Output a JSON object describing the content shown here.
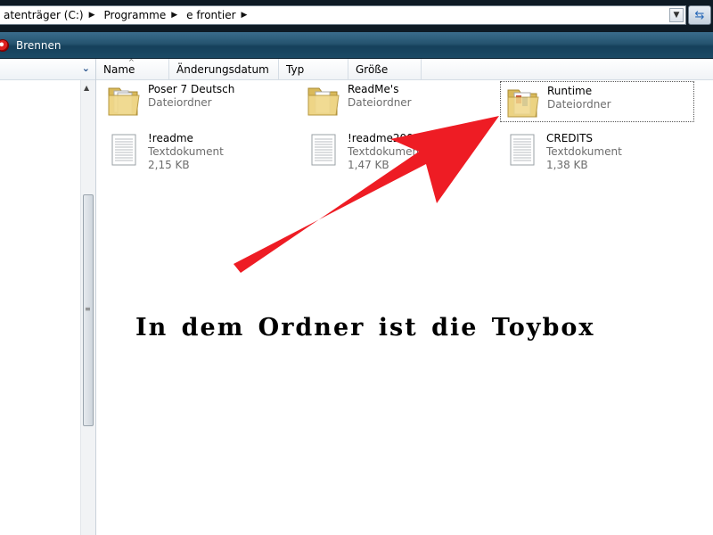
{
  "address": {
    "crumbs": [
      "atenträger (C:)",
      "Programme",
      "e frontier"
    ]
  },
  "toolbar": {
    "burn_label": "Brennen"
  },
  "columns": {
    "name": "Name",
    "date": "Änderungsdatum",
    "type": "Typ",
    "size": "Größe"
  },
  "items": [
    {
      "name": "Poser 7 Deutsch",
      "type": "Dateiordner",
      "size": "",
      "icon": "folder-icon"
    },
    {
      "name": "ReadMe's",
      "type": "Dateiordner",
      "size": "",
      "icon": "folder-icon"
    },
    {
      "name": "Runtime",
      "type": "Dateiordner",
      "size": "",
      "icon": "folder-icon"
    },
    {
      "name": "!readme",
      "type": "Textdokument",
      "size": "2,15 KB",
      "icon": "text-document-icon"
    },
    {
      "name": "!readme2001",
      "type": "Textdokument",
      "size": "1,47 KB",
      "icon": "text-document-icon"
    },
    {
      "name": "CREDITS",
      "type": "Textdokument",
      "size": "1,38 KB",
      "icon": "text-document-icon"
    }
  ],
  "annotation": {
    "text": "In dem  Ordner ist die Toybox"
  },
  "colors": {
    "arrow": "#ee1c24",
    "toolbar": "#25536f"
  }
}
